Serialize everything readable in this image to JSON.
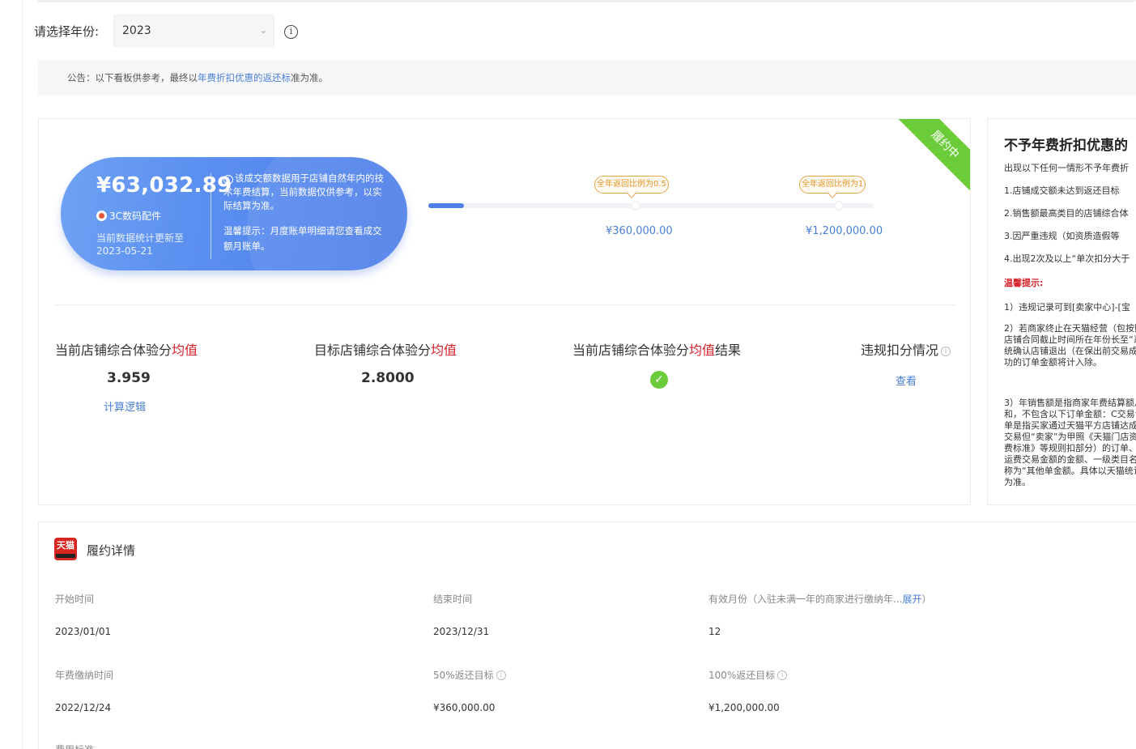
{
  "year_selector": {
    "label": "请选择年份:",
    "value": "2023"
  },
  "notice": {
    "prefix": "公告：以下看板供参考，最终以",
    "link": "年费折扣优惠的返还标",
    "suffix": "准为准。"
  },
  "status_ribbon": "履约中",
  "turnover": {
    "amount": "¥63,032.89",
    "category": "3C数码配件",
    "update_text": "当前数据统计更新至2023-05-21",
    "desc": "该成交额数据用于店铺自然年内的技术年费结算，当前数据仅供参考，以实际结算为准。",
    "tip": "温馨提示：月度账单明细请您查看成交额月账单。",
    "progress_fraction": 0.08
  },
  "targets": [
    {
      "tag": "全年返回比例为0.5",
      "value": "¥360,000.00"
    },
    {
      "tag": "全年返回比例为1",
      "value": "¥1,200,000.00"
    }
  ],
  "metrics": {
    "current_score": {
      "title_prefix": "当前店铺综合体验分",
      "title_red": "均值",
      "value": "3.959",
      "link": "计算逻辑"
    },
    "target_score": {
      "title_prefix": "目标店铺综合体验分",
      "title_red": "均值",
      "value": "2.8000"
    },
    "result": {
      "title_prefix": "当前店铺综合体验分",
      "title_red": "均值",
      "title_suffix": "结果"
    },
    "violation": {
      "title": "违规扣分情况",
      "link": "查看"
    }
  },
  "right_panel": {
    "title": "不予年费折扣优惠的",
    "intro": "出现以下任何一情形不予年费折",
    "items": [
      "1.店铺成交额未达到返还目标",
      "2.销售额最高类目的店铺综合体",
      "3.因严重违规（如资质造假等",
      "4.出现2次及以上“单次扣分大于"
    ],
    "tip_title": "温馨提示:",
    "tips": [
      "1）违规记录可到[卖家中心]-[宝",
      "2）若商家终止在天猫经营（包按照店铺合同截止时间所在年份长至“系统确认店铺退出（在保出前交易成功的订单金额将计入除。",
      "3）年销售额是指商家年费结算额总和，不包含以下订单金额：C交易订单是指买家通过天猫平方店铺达成交易但“卖家”为甲照《天猫门店资费标准》等规则扣部分）的订单、运费交易金额的金额、一级类目名称为“其他单金额。具体以天猫统计为准。"
    ]
  },
  "detail": {
    "title": "履约详情",
    "logo_text": "天猫",
    "fields": [
      {
        "label": "开始时间",
        "value": "2023/01/01"
      },
      {
        "label": "结束时间",
        "value": "2023/12/31"
      },
      {
        "label": "有效月份（入驻未满一年的商家进行缴纳年...",
        "link": "展开",
        "label_suffix": "）",
        "value": "12"
      },
      {
        "label": "年费缴纳时间",
        "value": "2022/12/24"
      },
      {
        "label": "50%返还目标",
        "value": "¥360,000.00"
      },
      {
        "label": "100%返还目标",
        "value": "¥1,200,000.00"
      }
    ],
    "next_label": "费用标准"
  }
}
